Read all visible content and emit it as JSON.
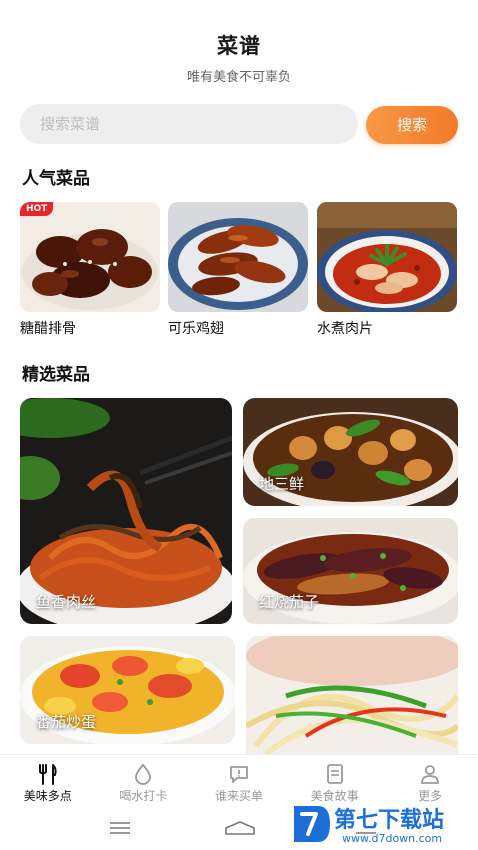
{
  "header": {
    "title": "菜谱",
    "subtitle": "唯有美食不可辜负"
  },
  "search": {
    "placeholder": "搜索菜谱",
    "button": "搜索"
  },
  "popular": {
    "title": "人气菜品",
    "badge": "HOT",
    "items": [
      {
        "label": "糖醋排骨"
      },
      {
        "label": "可乐鸡翅"
      },
      {
        "label": "水煮肉片"
      }
    ]
  },
  "featured": {
    "title": "精选菜品",
    "items": [
      {
        "label": "鱼香肉丝"
      },
      {
        "label": "地三鲜"
      },
      {
        "label": "红烧茄子"
      },
      {
        "label": "番茄炒蛋"
      },
      {
        "label": ""
      }
    ]
  },
  "tabs": [
    {
      "label": "美味多点",
      "icon": "fork-knife-icon",
      "active": true
    },
    {
      "label": "喝水打卡",
      "icon": "water-drop-icon",
      "active": false
    },
    {
      "label": "谁来买单",
      "icon": "chat-bubble-icon",
      "active": false
    },
    {
      "label": "美食故事",
      "icon": "book-icon",
      "active": false
    },
    {
      "label": "更多",
      "icon": "person-icon",
      "active": false
    }
  ],
  "watermark": {
    "text": "第七下载站",
    "url": "www.d7down.com"
  },
  "colors": {
    "accent": "#f27a2a",
    "hot": "#e8252a"
  }
}
